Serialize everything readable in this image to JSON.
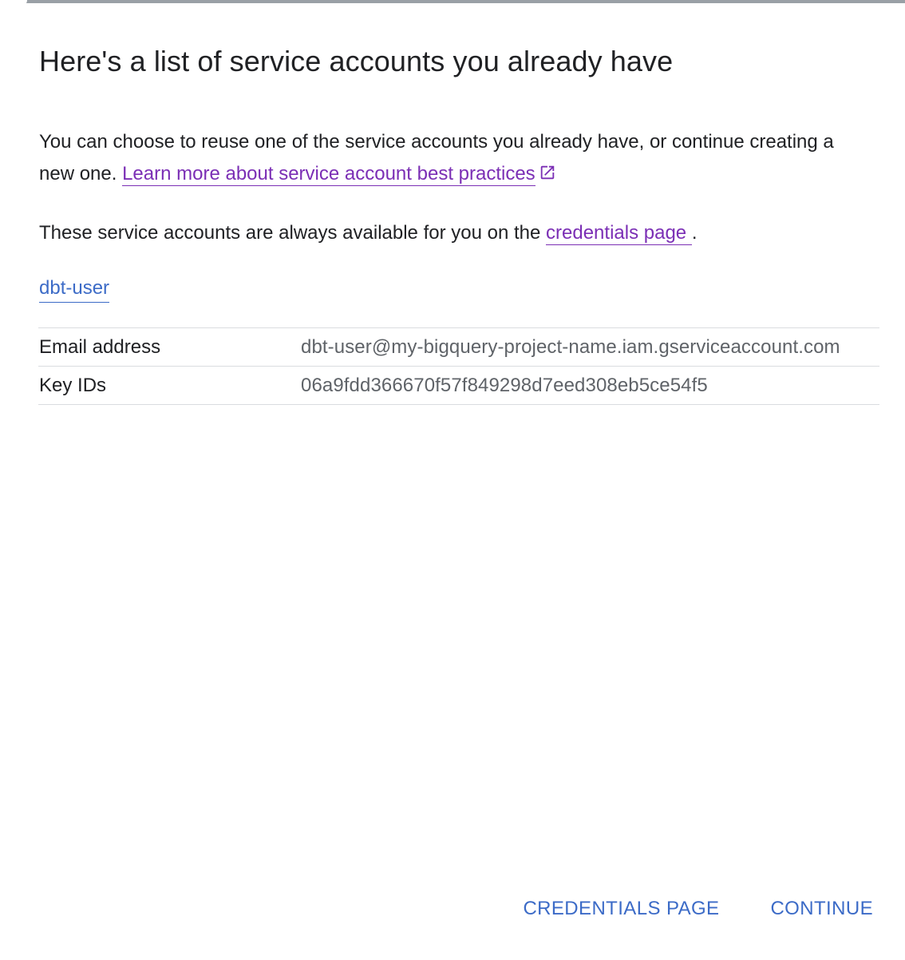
{
  "dialog": {
    "title": "Here's a list of service accounts you already have",
    "intro_text": "You can choose to reuse one of the service accounts you already have, or continue creating a new one.",
    "learn_more_link": "Learn more about service account best practices",
    "availability_text": "These service accounts are always available for you on the",
    "credentials_link": "credentials page",
    "availability_suffix": "."
  },
  "account": {
    "name": "dbt-user",
    "rows": [
      {
        "label": "Email address",
        "value": "dbt-user@my-bigquery-project-name.iam.gserviceaccount.com"
      },
      {
        "label": "Key IDs",
        "value": "06a9fdd366670f57f849298d7eed308eb5ce54f5"
      }
    ]
  },
  "actions": {
    "credentials_button": "CREDENTIALS PAGE",
    "continue_button": "CONTINUE"
  },
  "icons": {
    "external_link": "open-in-new-icon"
  },
  "colors": {
    "title_text": "#202124",
    "visited_link": "#7b2fb5",
    "primary_link": "#3c6bc7",
    "secondary_text": "#5f6368",
    "divider": "#dadce0"
  }
}
